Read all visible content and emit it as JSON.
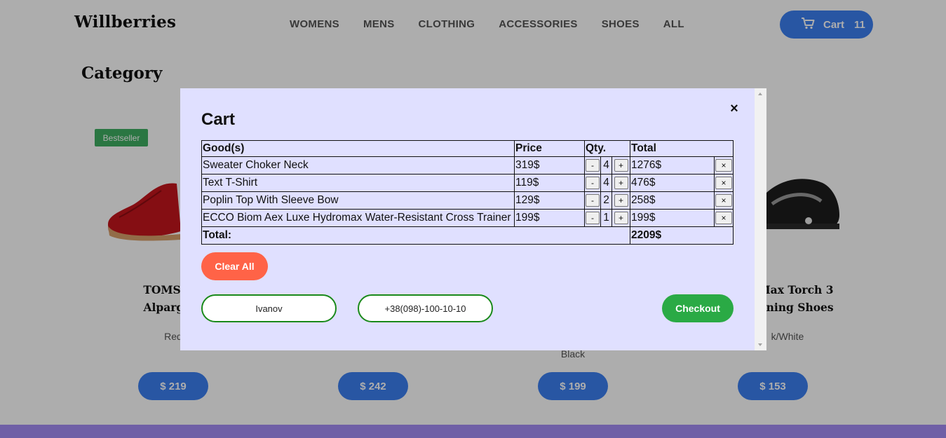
{
  "header": {
    "logo": "Willberries",
    "nav": [
      "WOMENS",
      "MENS",
      "CLOTHING",
      "ACCESSORIES",
      "SHOES",
      "ALL"
    ],
    "cart_label": "Cart",
    "cart_count": "11"
  },
  "page": {
    "category_title": "Category"
  },
  "products": [
    {
      "badge": "Bestseller",
      "name_line1": "TOMS Wo",
      "name_line2": "Alpargata",
      "color": "Red",
      "price": "$ 219"
    },
    {
      "name_line1": "",
      "name_line2": "",
      "color": "",
      "price": "$ 242"
    },
    {
      "name_line1": "",
      "name_line2": "",
      "color": "Black",
      "price": "$ 199"
    },
    {
      "name_line1": "Max Torch 3",
      "name_line2": "nning Shoes",
      "color": "k/White",
      "price": "$ 153"
    }
  ],
  "modal": {
    "title": "Cart",
    "close": "×",
    "headers": {
      "good": "Good(s)",
      "price": "Price",
      "qty": "Qty.",
      "total": "Total"
    },
    "rows": [
      {
        "name": "Sweater Choker Neck",
        "price": "319$",
        "qty": "4",
        "total": "1276$"
      },
      {
        "name": "Text T-Shirt",
        "price": "119$",
        "qty": "4",
        "total": "476$"
      },
      {
        "name": "Poplin Top With Sleeve Bow",
        "price": "129$",
        "qty": "2",
        "total": "258$"
      },
      {
        "name": "ECCO Biom Aex Luxe Hydromax Water-Resistant Cross Trainer",
        "price": "199$",
        "qty": "1",
        "total": "199$"
      }
    ],
    "minus": "-",
    "plus": "+",
    "delete": "×",
    "total_label": "Total:",
    "total_value": "2209$",
    "clear_all": "Clear All",
    "name_value": "Ivanov",
    "phone_value": "+38(098)-100-10-10",
    "checkout": "Checkout"
  },
  "colors": {
    "accent_blue": "#3b7ff0",
    "clear_red": "#ff6347",
    "checkout_green": "#2aaa45",
    "modal_bg": "#e0e0ff",
    "badge_green": "#3fae62",
    "footer_purple": "#a48cf5"
  },
  "icons": {
    "cart": "shopping-cart-icon",
    "close": "close-icon"
  }
}
